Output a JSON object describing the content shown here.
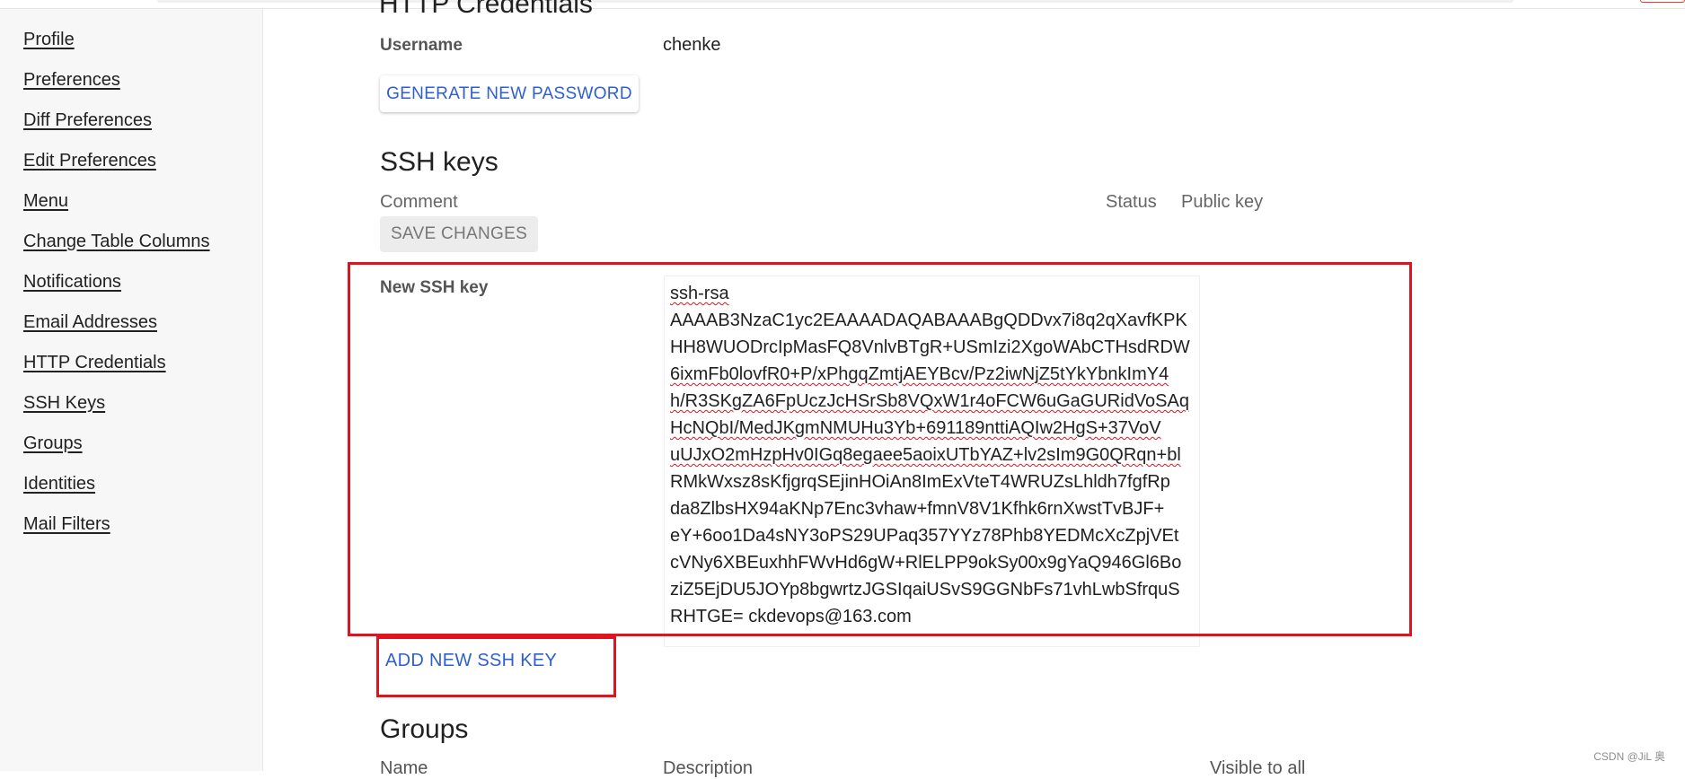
{
  "sidebar": {
    "items": [
      {
        "label": "Profile"
      },
      {
        "label": "Preferences"
      },
      {
        "label": "Diff Preferences"
      },
      {
        "label": "Edit Preferences"
      },
      {
        "label": "Menu"
      },
      {
        "label": "Change Table Columns"
      },
      {
        "label": "Notifications"
      },
      {
        "label": "Email Addresses"
      },
      {
        "label": "HTTP Credentials"
      },
      {
        "label": "SSH Keys"
      },
      {
        "label": "Groups"
      },
      {
        "label": "Identities"
      },
      {
        "label": "Mail Filters"
      }
    ]
  },
  "http_credentials": {
    "title": "HTTP Credentials",
    "username_label": "Username",
    "username_value": "chenke",
    "generate_button": "GENERATE NEW PASSWORD"
  },
  "ssh_keys": {
    "title": "SSH keys",
    "columns": {
      "comment": "Comment",
      "status": "Status",
      "public_key": "Public key"
    },
    "save_button": "SAVE CHANGES",
    "new_key_label": "New SSH key",
    "new_key_lines": [
      "ssh-rsa",
      "AAAAB3NzaC1yc2EAAAADAQABAAABgQDDvx7i8q2qXavfKPK",
      "HH8WUODrcIpMasFQ8VnlvBTgR+USmIzi2XgoWAbCTHsdRDW",
      "6ixmFb0lovfR0+P/xPhgqZmtjAEYBcv/Pz2iwNjZ5tYkYbnkImY4",
      "h/R3SKgZA6FpUczJcHSrSb8VQxW1r4oFCW6uGaGURidVoSAq",
      "HcNQbI/MedJKgmNMUHu3Yb+691189nttiAQIw2HgS+37VoV",
      "uUJxO2mHzpHv0IGq8egaee5aoixUTbYAZ+lv2sIm9G0QRqn+bl",
      "RMkWxsz8sKfjgrqSEjinHOiAn8ImExVteT4WRUZsLhldh7fgfRp",
      "da8ZlbsHX94aKNp7Enc3vhaw+fmnV8V1Kfhk6rnXwstTvBJF+",
      "eY+6oo1Da4sNY3oPS29UPaq357YYz78Phb8YEDMcXcZpjVEt",
      "cVNy6XBEuxhhFWvHd6gW+RlELPP9okSy00x9gYaQ946Gl6Bo",
      "ziZ5EjDU5JOYp8bgwrtzJGSIqaiUSvS9GGNbFs71vhLwbSfrquS",
      "RHTGE= ckdevops@163.com"
    ],
    "add_button": "ADD NEW SSH KEY"
  },
  "groups": {
    "title": "Groups",
    "columns": {
      "name": "Name",
      "description": "Description",
      "visible": "Visible to all"
    }
  },
  "watermark": "CSDN @JiL 奥",
  "colors": {
    "accent": "#2e5fcf",
    "highlight_box": "#e0141e"
  }
}
